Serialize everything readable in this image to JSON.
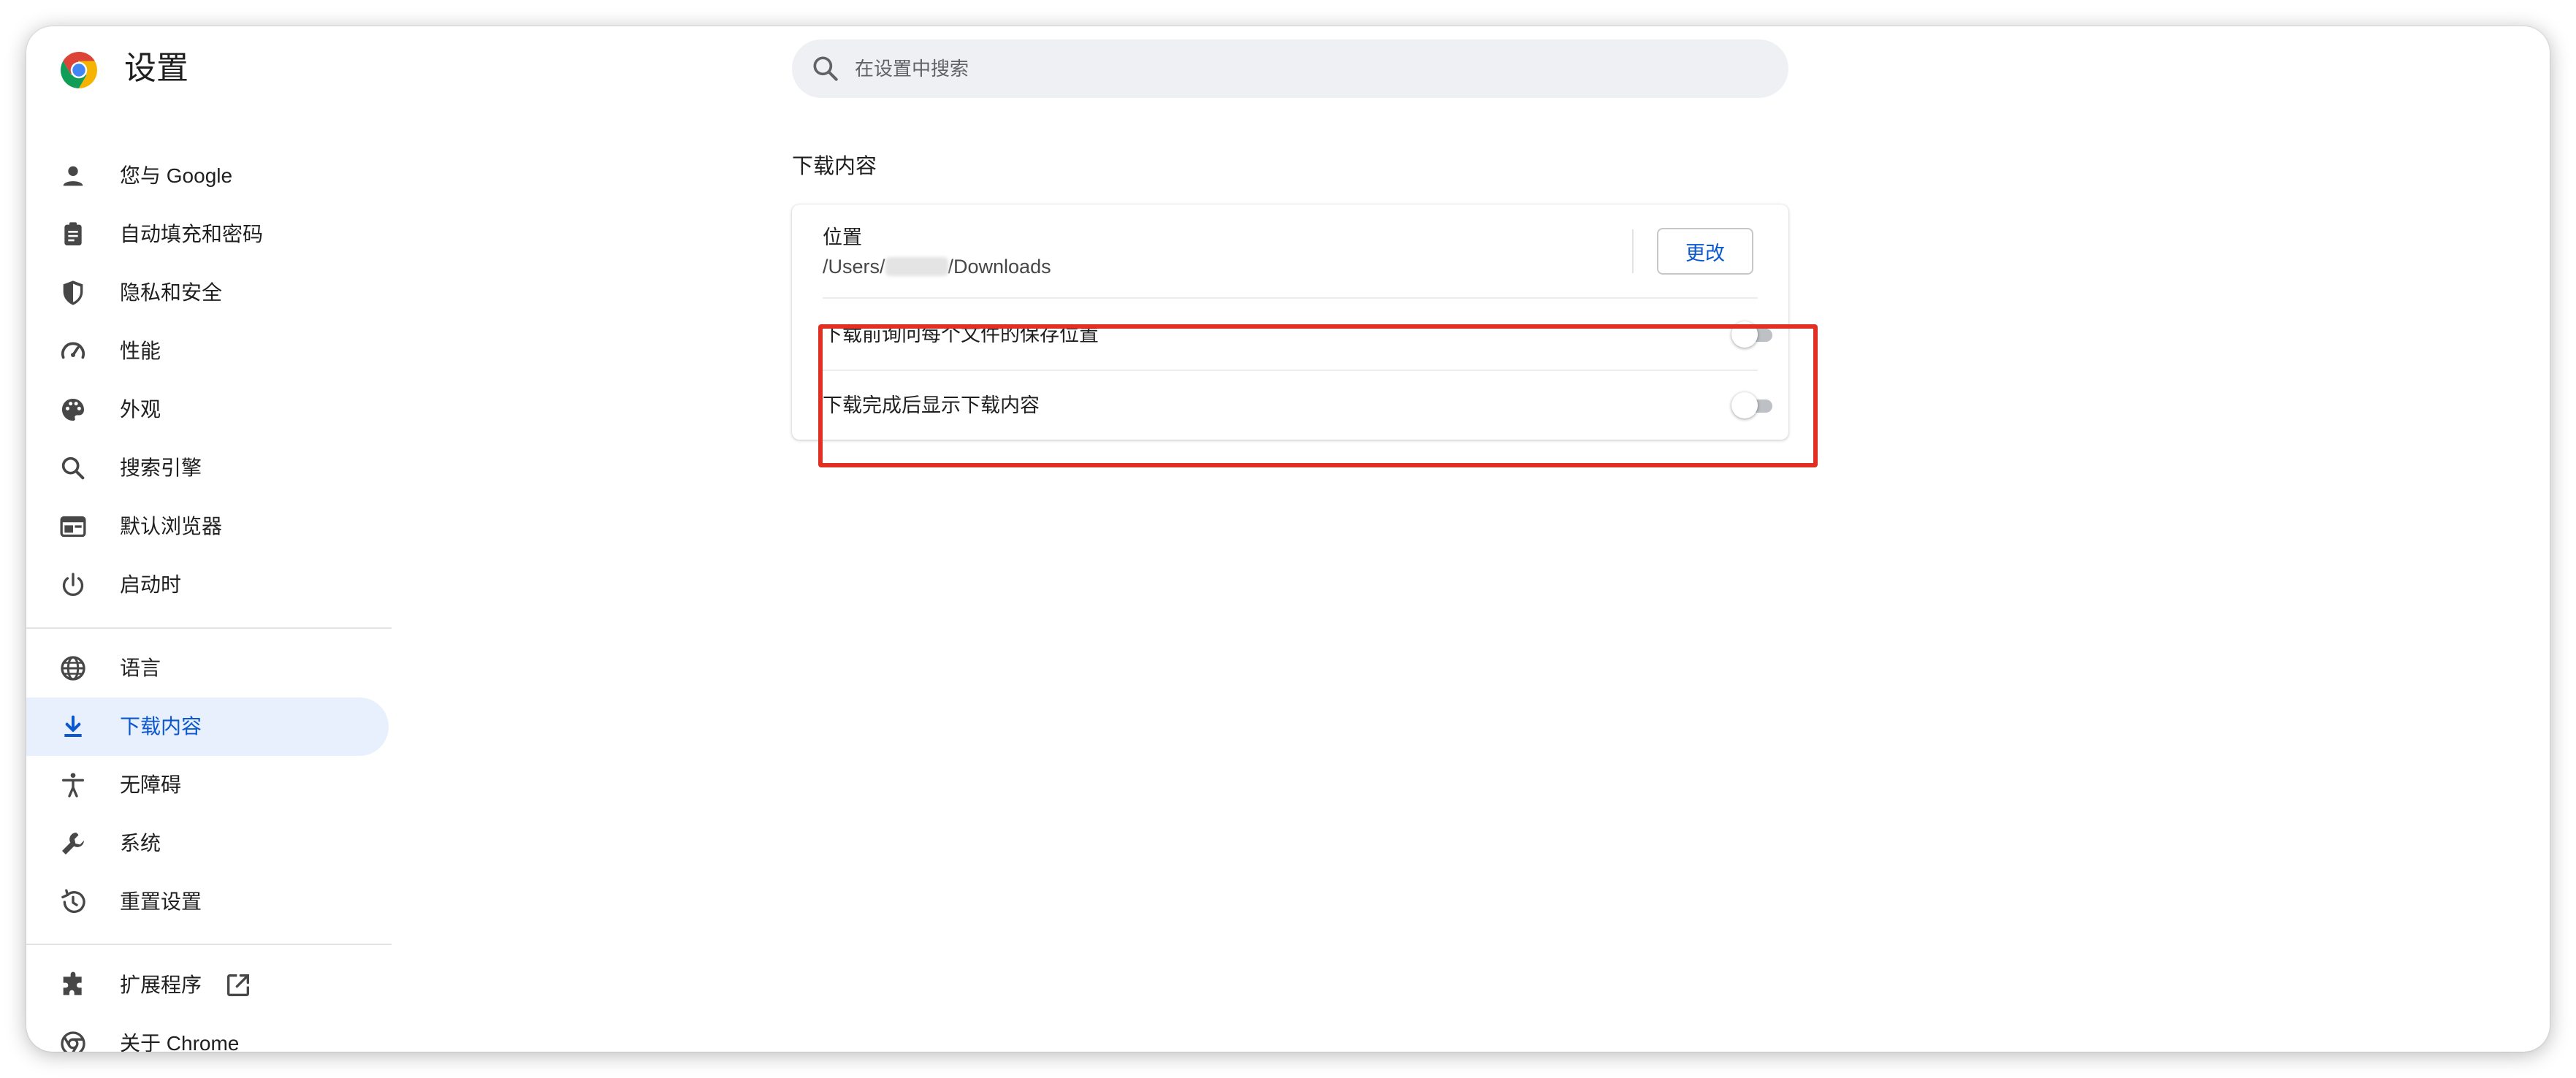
{
  "header": {
    "title": "设置",
    "search_placeholder": "在设置中搜索"
  },
  "sidebar": {
    "items": [
      {
        "label": "您与 Google",
        "icon": "person-icon"
      },
      {
        "label": "自动填充和密码",
        "icon": "clipboard-icon"
      },
      {
        "label": "隐私和安全",
        "icon": "shield-icon"
      },
      {
        "label": "性能",
        "icon": "speedometer-icon"
      },
      {
        "label": "外观",
        "icon": "palette-icon"
      },
      {
        "label": "搜索引擎",
        "icon": "search-icon"
      },
      {
        "label": "默认浏览器",
        "icon": "browser-window-icon"
      },
      {
        "label": "启动时",
        "icon": "power-icon"
      },
      {
        "label": "语言",
        "icon": "globe-icon"
      },
      {
        "label": "下载内容",
        "icon": "download-icon",
        "active": true
      },
      {
        "label": "无障碍",
        "icon": "accessibility-icon"
      },
      {
        "label": "系统",
        "icon": "wrench-icon"
      },
      {
        "label": "重置设置",
        "icon": "history-icon"
      },
      {
        "label": "扩展程序",
        "icon": "puzzle-icon"
      },
      {
        "label": "关于 Chrome",
        "icon": "chrome-icon"
      }
    ]
  },
  "main": {
    "section_title": "下载内容",
    "location": {
      "label": "位置",
      "path_prefix": "/Users/",
      "path_suffix": "/Downloads",
      "change_label": "更改"
    },
    "toggles": [
      {
        "label": "下载前询问每个文件的保存位置",
        "enabled": false
      },
      {
        "label": "下载完成后显示下载内容",
        "enabled": false
      }
    ]
  },
  "colors": {
    "accent": "#0b57d0",
    "active_bg": "#e8f0fe",
    "highlight": "#e03024"
  }
}
